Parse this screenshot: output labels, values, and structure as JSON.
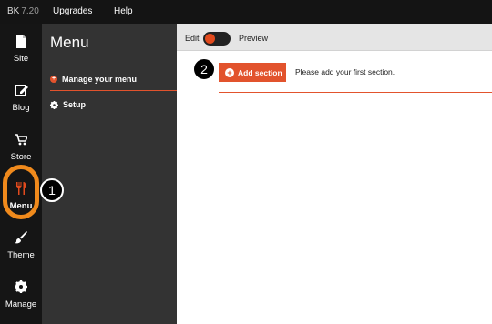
{
  "topbar": {
    "logo": "BK",
    "version": "7.20",
    "links": [
      "Upgrades",
      "Help"
    ]
  },
  "rail": {
    "items": [
      {
        "label": "Site",
        "icon": "page-icon"
      },
      {
        "label": "Blog",
        "icon": "edit-icon"
      },
      {
        "label": "Store",
        "icon": "cart-icon"
      },
      {
        "label": "Menu",
        "icon": "fork-knife-icon"
      },
      {
        "label": "Theme",
        "icon": "brush-icon"
      },
      {
        "label": "Manage",
        "icon": "gear-icon"
      }
    ],
    "active": "Menu"
  },
  "callouts": [
    "1",
    "2"
  ],
  "panel": {
    "title": "Menu",
    "items": [
      {
        "label": "Manage your menu",
        "icon": "plus-circle-icon"
      },
      {
        "label": "Setup",
        "icon": "gear-icon"
      }
    ]
  },
  "toolbar": {
    "edit_label": "Edit",
    "preview_label": "Preview"
  },
  "content": {
    "add_section_label": "Add section",
    "hint": "Please add your first section."
  },
  "colors": {
    "accent": "#e2532d",
    "highlight_ring": "#f08a1c",
    "rail_bg": "#151515",
    "panel_bg": "#333333"
  }
}
